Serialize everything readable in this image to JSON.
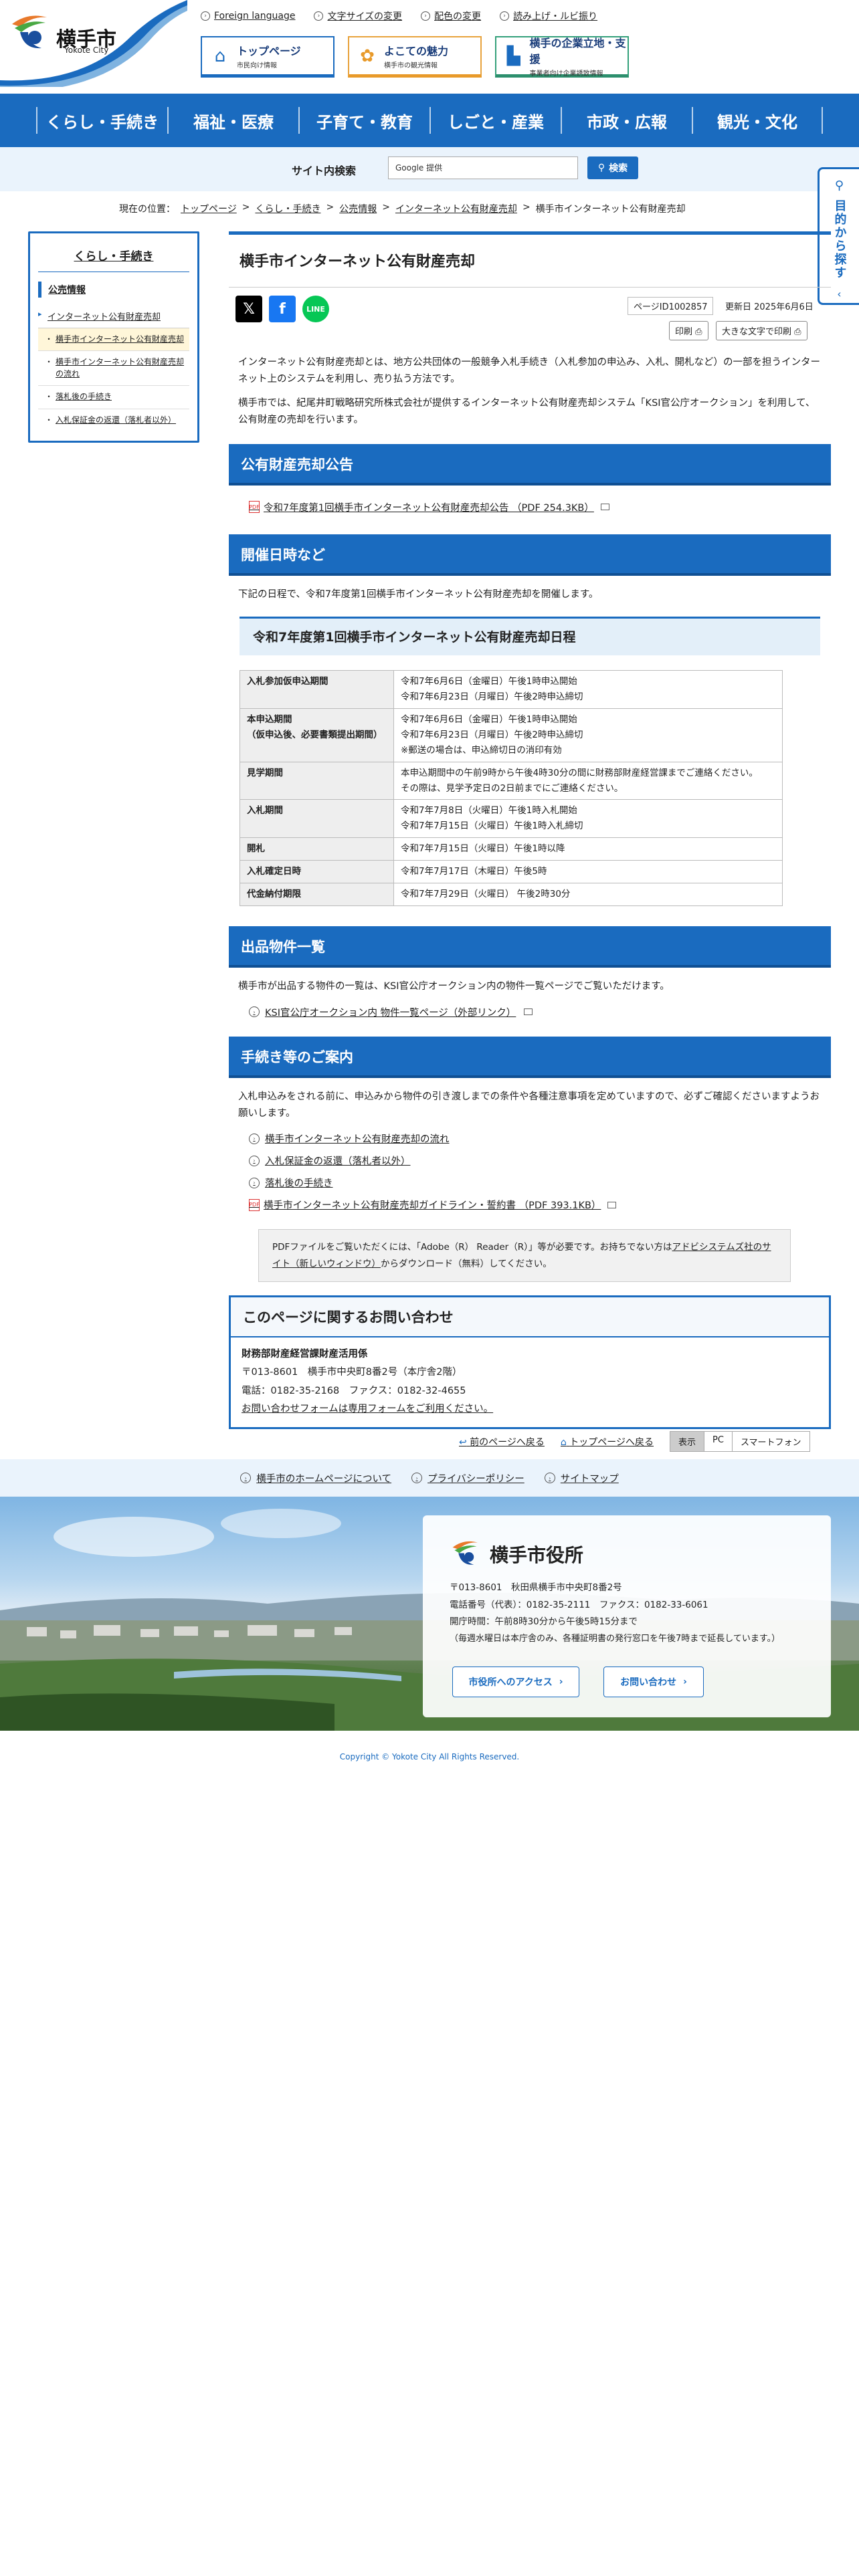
{
  "header": {
    "logo_name": "横手市",
    "logo_sub": "Yokote City",
    "util_links": [
      "Foreign language",
      "文字サイズの変更",
      "配色の変更",
      "読み上げ・ルビ振り"
    ],
    "quick": [
      {
        "title": "トップページ",
        "sub": "市民向け情報"
      },
      {
        "title": "よこての魅力",
        "sub": "横手市の観光情報"
      },
      {
        "title": "横手の企業立地・支援",
        "sub": "事業者向け企業誘致情報"
      }
    ]
  },
  "gnav": [
    "くらし・手続き",
    "福祉・医療",
    "子育て・教育",
    "しごと・産業",
    "市政・広報",
    "観光・文化"
  ],
  "search": {
    "label": "サイト内検索",
    "placeholder": "Google 提供",
    "button": "検索"
  },
  "sidetab": {
    "label": "目的から探す"
  },
  "breadcrumb": {
    "lead": "現在の位置：",
    "items": [
      "トップページ",
      "くらし・手続き",
      "公売情報",
      "インターネット公有財産売却"
    ],
    "sep": ">",
    "current": "横手市インターネット公有財産売却"
  },
  "lnav": {
    "title": "くらし・手続き",
    "section": "公売情報",
    "row": "インターネット公有財産売却",
    "subs": [
      "横手市インターネット公有財産売却",
      "横手市インターネット公有財産売却の流れ",
      "落札後の手続き",
      "入札保証金の返還（落札者以外）"
    ]
  },
  "page": {
    "title": "横手市インターネット公有財産売却",
    "page_id": "ページID1002857",
    "updated": "更新日 2025年6月6日",
    "print": "印刷",
    "print_large": "大きな文字で印刷",
    "intro1": "インターネット公有財産売却とは、地方公共団体の一般競争入札手続き（入札参加の申込み、入札、開札など）の一部を担うインターネット上のシステムを利用し、売り払う方法です。",
    "intro2": "横手市では、紀尾井町戦略研究所株式会社が提供するインターネット公有財産売却システム「KSI官公庁オークション」を利用して、公有財産の売却を行います。",
    "h_notice": "公有財産売却公告",
    "notice_pdf": "令和7年度第1回横手市インターネット公有財産売却公告 （PDF 254.3KB）",
    "h_schedule": "開催日時など",
    "schedule_lead": "下記の日程で、令和7年度第1回横手市インターネット公有財産売却を開催します。",
    "h3_schedule": "令和7年度第1回横手市インターネット公有財産売却日程",
    "schedule": [
      {
        "label": "入札参加仮申込期間",
        "lines": [
          "令和7年6月6日（金曜日）午後1時申込開始",
          "令和7年6月23日（月曜日）午後2時申込締切"
        ]
      },
      {
        "label": "本申込期間\n（仮申込後、必要書類提出期間）",
        "lines": [
          "令和7年6月6日（金曜日）午後1時申込開始",
          "令和7年6月23日（月曜日）午後2時申込締切",
          "※郵送の場合は、申込締切日の消印有効"
        ]
      },
      {
        "label": "見学期間",
        "lines": [
          "本申込期間中の午前9時から午後4時30分の間に財務部財産経営課までご連絡ください。",
          "その際は、見学予定日の2日前までにご連絡ください。"
        ]
      },
      {
        "label": "入札期間",
        "lines": [
          "令和7年7月8日（火曜日）午後1時入札開始",
          "令和7年7月15日（火曜日）午後1時入札締切"
        ]
      },
      {
        "label": "開札",
        "lines": [
          "令和7年7月15日（火曜日）午後1時以降"
        ]
      },
      {
        "label": "入札確定日時",
        "lines": [
          "令和7年7月17日（木曜日）午後5時"
        ]
      },
      {
        "label": "代金納付期限",
        "lines": [
          "令和7年7月29日（火曜日） 午後2時30分"
        ]
      }
    ],
    "h_items": "出品物件一覧",
    "items_lead": "横手市が出品する物件の一覧は、KSI官公庁オークション内の物件一覧ページでご覧いただけます。",
    "items_link": "KSI官公庁オークション内 物件一覧ページ（外部リンク）",
    "h_guide": "手続き等のご案内",
    "guide_lead": "入札申込みをされる前に、申込みから物件の引き渡しまでの条件や各種注意事項を定めていますので、必ずご確認くださいますようお願いします。",
    "guide_links": [
      "横手市インターネット公有財産売却の流れ",
      "入札保証金の返還（落札者以外）",
      "落札後の手続き"
    ],
    "guide_pdf": "横手市インターネット公有財産売却ガイドライン・誓約書 （PDF 393.1KB）",
    "pdf_note_a": "PDFファイルをご覧いただくには、「Adobe（R） Reader（R）」等が必要です。お持ちでない方は",
    "pdf_note_link": "アドビシステムズ社のサイト（新しいウィンドウ）",
    "pdf_note_b": "からダウンロード（無料）してください。",
    "contact_h": "このページに関するお問い合わせ",
    "contact_dept": "財務部財産経営課財産活用係",
    "contact_addr": "〒013-8601　横手市中央町8番2号（本庁舎2階）",
    "contact_tel": "電話：0182-35-2168　ファクス：0182-32-4655",
    "contact_form": "お問い合わせフォームは専用フォームをご利用ください。"
  },
  "footer_nav": {
    "back": "前のページへ戻る",
    "top": "トップページへ戻る",
    "display": [
      "表示",
      "PC",
      "スマートフォン"
    ]
  },
  "footer_links": [
    "横手市のホームページについて",
    "プライバシーポリシー",
    "サイトマップ"
  ],
  "footer_card": {
    "name": "横手市役所",
    "addr": "〒013-8601　秋田県横手市中央町8番2号",
    "tel": "電話番号（代表）：0182-35-2111　ファクス：0182-33-6061",
    "hours1": "開庁時間：午前8時30分から午後5時15分まで",
    "hours2": "（毎週水曜日は本庁舎のみ、各種証明書の発行窓口を午後7時まで延長しています。）",
    "btn_access": "市役所へのアクセス",
    "btn_contact": "お問い合わせ"
  },
  "copyright": "Copyright © Yokote City All Rights Reserved."
}
